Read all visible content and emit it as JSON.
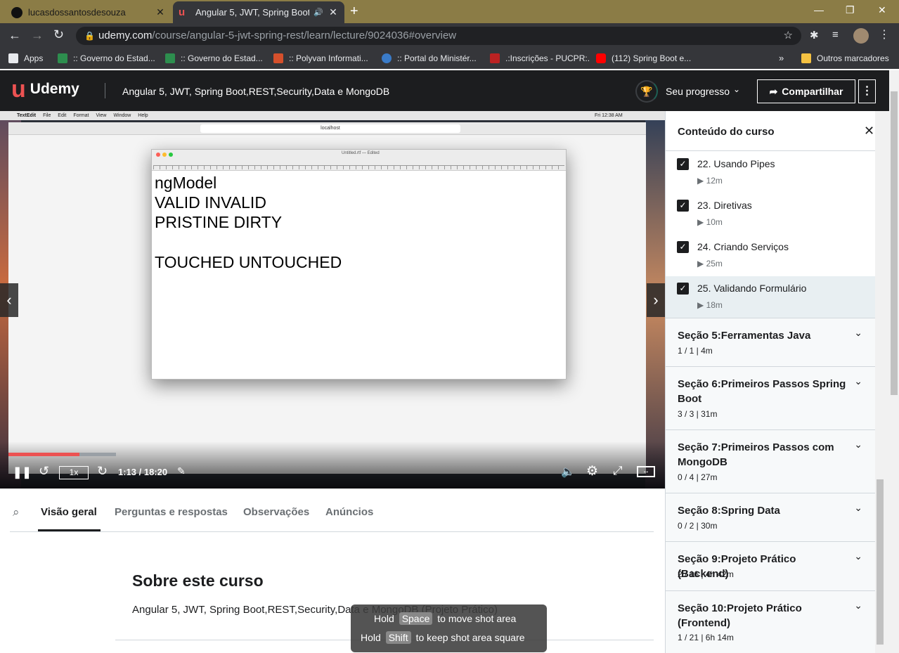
{
  "browser": {
    "tabs": [
      {
        "title": "lucasdossantosdesouza"
      },
      {
        "title": "Angular 5, JWT, Spring Boot,"
      }
    ],
    "url_host": "udemy.com",
    "url_path": "/course/angular-5-jwt-spring-rest/learn/lecture/9024036#overview",
    "bookmarks": [
      "Apps",
      ":: Governo do Estad...",
      ":: Governo do Estad...",
      ":: Polyvan Informati...",
      ":: Portal do Ministér...",
      ".:Inscrições - PUCPR:.",
      "(112) Spring Boot e..."
    ],
    "other_bookmarks": "Outros marcadores"
  },
  "header": {
    "logo": "Udemy",
    "course_title": "Angular 5, JWT, Spring Boot,REST,Security,Data e MongoDB",
    "progress_label": "Seu progresso",
    "share_label": "Compartilhar"
  },
  "video": {
    "mac_menu": [
      "TextEdit",
      "File",
      "Edit",
      "Format",
      "View",
      "Window",
      "Help"
    ],
    "mac_clock": "Fri 12:38 AM",
    "safari_url": "localhost",
    "textedit_title": "Untitled.rtf — Edited",
    "doc_lines": [
      "ngModel",
      "VALID INVALID",
      "PRISTINE  DIRTY",
      "",
      "TOUCHED UNTOUCHED"
    ],
    "speed": "1x",
    "time": "1:13 / 18:20",
    "progress": 0.066
  },
  "tabs": [
    "Visão geral",
    "Perguntas e respostas",
    "Observações",
    "Anúncios"
  ],
  "overview": {
    "heading": "Sobre este curso",
    "subtitle": "Angular 5, JWT, Spring Boot,REST,Security,Data e MongoDB (Projeto Prático)"
  },
  "sidebar": {
    "title": "Conteúdo do curso",
    "lectures": [
      {
        "title": "22. Usando Pipes",
        "duration": "12m"
      },
      {
        "title": "23. Diretivas",
        "duration": "10m"
      },
      {
        "title": "24. Criando Serviços",
        "duration": "25m"
      },
      {
        "title": "25. Validando Formulário",
        "duration": "18m"
      }
    ],
    "sections": [
      {
        "title": "Seção 5:Ferramentas Java",
        "stats": "1 / 1 | 4m"
      },
      {
        "title": "Seção 6:Primeiros Passos Spring Boot",
        "stats": "3 / 3 | 31m"
      },
      {
        "title": "Seção 7:Primeiros Passos com MongoDB",
        "stats": "0 / 4 | 27m"
      },
      {
        "title": "Seção 8:Spring Data",
        "stats": "0 / 2 | 30m"
      },
      {
        "title": "Seção 9:Projeto Prático (Backend)",
        "stats": "2 / 16 | 4h 42m"
      },
      {
        "title": "Seção 10:Projeto Prático (Frontend)",
        "stats": "1 / 21 | 6h 14m"
      }
    ]
  },
  "toast": {
    "line1_pre": "Hold",
    "line1_key": "Space",
    "line1_post": "to move shot area",
    "line2_pre": "Hold",
    "line2_key": "Shift",
    "line2_post": "to keep shot area square"
  }
}
